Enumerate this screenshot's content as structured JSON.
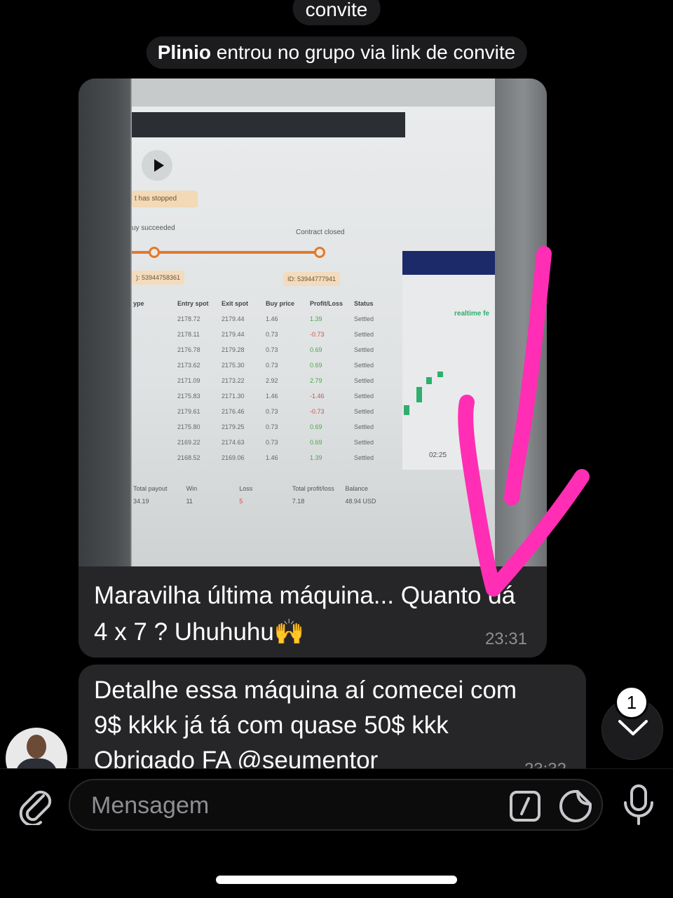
{
  "service": {
    "top_text": "convite",
    "join_user": "Plinio",
    "join_text": " entrou no grupo via link de convite"
  },
  "messages": [
    {
      "caption": "Maravilha última máquina... Quanto dá 4 x 7 ? Uhuhuhu🙌",
      "time": "23:31"
    },
    {
      "caption": "Detalhe essa máquina aí comecei com\n9$ kkkk já tá com quase 50$ kkk\nObrigado FA @seumentor",
      "time": "23:32"
    }
  ],
  "photo": {
    "status_stopped": "t has stopped",
    "buy_succeeded": "uy succeeded",
    "contract_closed": "Contract closed",
    "id_left": "): 53944758361",
    "id_right": "ID: 53944777941",
    "table_header": [
      "ype",
      "Entry spot",
      "Exit spot",
      "Buy price",
      "Profit/Loss",
      "Status"
    ],
    "table_rows": [
      [
        "",
        "2178.72",
        "2179.44",
        "1.46",
        "1.39",
        "Settled"
      ],
      [
        "",
        "2178.11",
        "2179.44",
        "0.73",
        "-0.73",
        "Settled"
      ],
      [
        "",
        "2176.78",
        "2179.28",
        "0.73",
        "0.69",
        "Settled"
      ],
      [
        "",
        "2173.62",
        "2175.30",
        "0.73",
        "0.69",
        "Settled"
      ],
      [
        "",
        "2171.09",
        "2173.22",
        "2.92",
        "2.79",
        "Settled"
      ],
      [
        "",
        "2175.83",
        "2171.30",
        "1.46",
        "-1.46",
        "Settled"
      ],
      [
        "",
        "2179.61",
        "2176.46",
        "0.73",
        "-0.73",
        "Settled"
      ],
      [
        "",
        "2175.80",
        "2179.25",
        "0.73",
        "0.69",
        "Settled"
      ],
      [
        "",
        "2169.22",
        "2174.63",
        "0.73",
        "0.69",
        "Settled"
      ],
      [
        "",
        "2168.52",
        "2169.06",
        "1.46",
        "1.39",
        "Settled"
      ]
    ],
    "totals_labels": [
      "Total payout",
      "Win",
      "Loss",
      "Total profit/loss",
      "Balance"
    ],
    "totals_values": [
      "34.19",
      "11",
      "5",
      "7.18",
      "48.94 USD"
    ],
    "realtime_label": "realtime fe",
    "chart_time": "02:25"
  },
  "composer": {
    "placeholder": "Mensagem"
  },
  "scroll": {
    "badge_count": "1"
  },
  "colors": {
    "bubble": "#262628",
    "annotation": "#ff2eb4",
    "background": "#000000"
  }
}
